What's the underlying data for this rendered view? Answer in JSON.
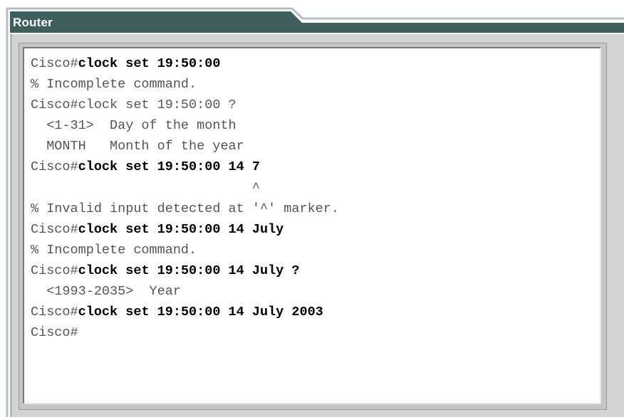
{
  "window": {
    "title": "Router",
    "colors": {
      "title_bar": "#3f5f5f",
      "tab_outline": "#a9b3b3",
      "frame": "#d4d4d4",
      "terminal_bg": "#ffffff",
      "output_text": "#555555",
      "command_text": "#000000"
    }
  },
  "terminal": {
    "lines": [
      {
        "prompt": "Cisco#",
        "command": "clock set 19:50:00"
      },
      {
        "prompt": "% Incomplete command.",
        "command": ""
      },
      {
        "prompt": "Cisco#clock set 19:50:00 ?",
        "command": ""
      },
      {
        "prompt": "  <1-31>  Day of the month",
        "command": ""
      },
      {
        "prompt": "  MONTH   Month of the year",
        "command": ""
      },
      {
        "prompt": "Cisco#",
        "command": "clock set 19:50:00 14 7"
      },
      {
        "prompt": "                            ^",
        "command": ""
      },
      {
        "prompt": "% Invalid input detected at '^' marker.",
        "command": ""
      },
      {
        "prompt": "Cisco#",
        "command": "clock set 19:50:00 14 July"
      },
      {
        "prompt": "% Incomplete command.",
        "command": ""
      },
      {
        "prompt": "Cisco#",
        "command": "clock set 19:50:00 14 July ?"
      },
      {
        "prompt": "  <1993-2035>  Year",
        "command": ""
      },
      {
        "prompt": "Cisco#",
        "command": "clock set 19:50:00 14 July 2003"
      },
      {
        "prompt": "Cisco#",
        "command": ""
      }
    ]
  }
}
